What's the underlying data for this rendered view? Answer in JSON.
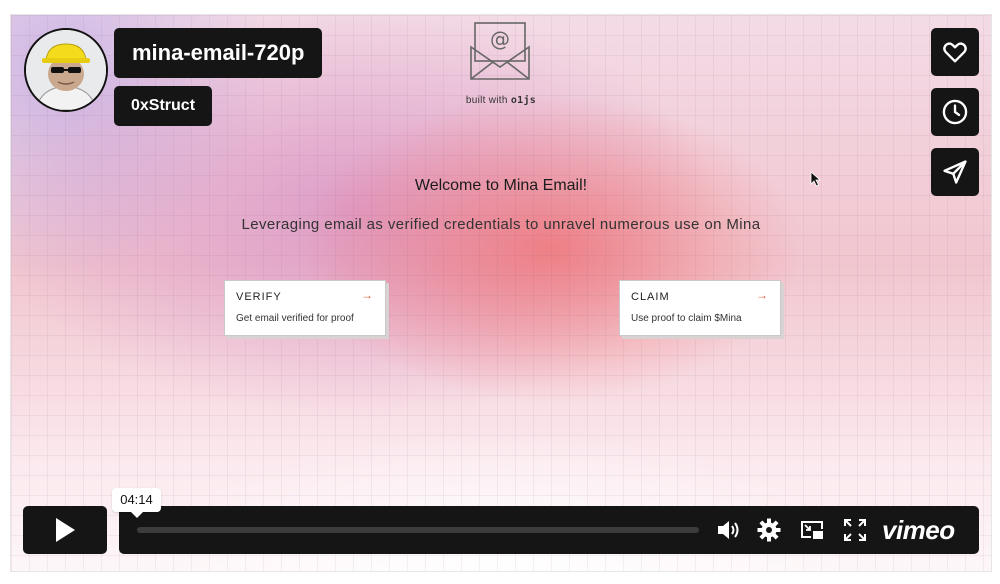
{
  "video": {
    "title": "mina-email-720p",
    "author": "0xStruct",
    "current_time": "04:14"
  },
  "page": {
    "built_with_prefix": "built with",
    "built_with_tool": "o1js",
    "welcome": "Welcome to Mina Email!",
    "tagline": "Leveraging email as verified credentials to unravel numerous use on Mina",
    "cards": [
      {
        "title": "VERIFY",
        "arrow": "→",
        "subtitle": "Get email verified for proof"
      },
      {
        "title": "CLAIM",
        "arrow": "→",
        "subtitle": "Use proof to claim $Mina"
      }
    ]
  },
  "player": {
    "brand": "vimeo",
    "side_icons": [
      "heart-icon",
      "clock-icon",
      "send-icon"
    ],
    "controls": [
      "volume-icon",
      "gear-icon",
      "pip-icon",
      "fullscreen-icon"
    ],
    "progress": 0.0
  },
  "colors": {
    "panel": "#151515",
    "accent_arrow": "#e05a3a"
  }
}
